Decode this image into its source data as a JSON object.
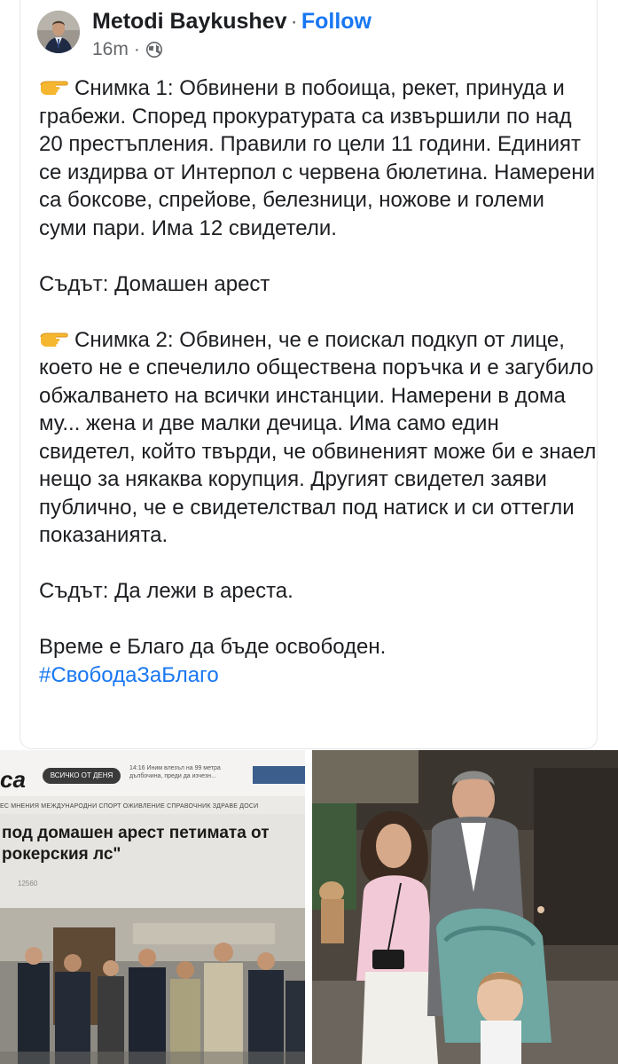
{
  "post": {
    "author": "Metodi Baykushev",
    "separator": "·",
    "follow_label": "Follow",
    "time": "16m",
    "meta_dot": "·",
    "paragraphs": [
      "Снимка 1: Обвинени в побоища, рекет, принуда и грабежи. Според прокуратурата са извършили по над 20 престъпления. Правили го цели 11 години. Единият се издирва от Интерпол с червена бюлетина. Намерени са боксове, спрейове, белезници, ножове и големи суми пари. Има 12 свидетели.",
      "Съдът: Домашен арест",
      "Снимка 2: Обвинен, че е поискал подкуп от лице, което не е спечелило обществена поръчка и е загубило обжалването на всички инстанции. Намерени в дома му... жена и две малки дечица. Има само един свидетел, който твърди, че обвиненият може би е знаел нещо за някаква корупция. Другият свидетел заяви публично, че е свидетелствал под натиск и си оттегли показанията.",
      "Съдът: Да лежи в ареста.",
      "Време е Благо да бъде освободен."
    ],
    "hashtag": "#СвободаЗаБлаго",
    "icons": {
      "avatar": "author-avatar",
      "privacy": "globe-icon",
      "pointing": "backhand-index-pointing-right-icon"
    }
  },
  "photo_left": {
    "logo_text": "са",
    "pill_text": "ВСИЧКО ОТ ДЕНЯ",
    "ticker_text": "14:16 Иним влезъл на 99 метра дълбочина, преди да изчезн...",
    "nav_text": "ЕС  МНЕНИЯ  МЕЖДУНАРОДНИ  СПОРТ  ОЖИВЛЕНИЕ  СПРАВОЧНИК  ЗДРАВЕ  ДОСИ",
    "headline": "под домашен арест петимата от рокерския лс\"",
    "views": "12560"
  },
  "colors": {
    "text": "#1c1e21",
    "secondary": "#65676b",
    "link": "#1877f2",
    "card_border": "#e4e6eb"
  }
}
